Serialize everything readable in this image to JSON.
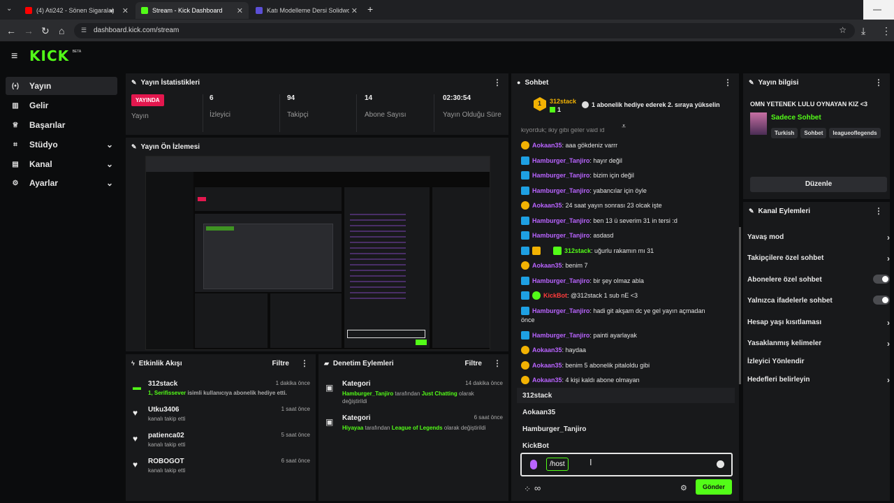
{
  "browser": {
    "tabs": [
      {
        "label": "(4) Ati242 - Sönen Sigaralar",
        "favicon_color": "#ff0000"
      },
      {
        "label": "Stream - Kick Dashboard",
        "favicon_color": "#53fc18"
      },
      {
        "label": "Katı Modelleme Dersi Solidworks",
        "favicon_color": "#5b4fd6"
      }
    ],
    "url": "dashboard.kick.com/stream"
  },
  "brand": {
    "logo": "KICK",
    "beta": "BETA",
    "accent": "#53fc18"
  },
  "sidebar": {
    "items": [
      {
        "label": "Yayın",
        "icon": "broadcast-icon"
      },
      {
        "label": "Gelir",
        "icon": "revenue-icon"
      },
      {
        "label": "Başarılar",
        "icon": "trophy-icon"
      },
      {
        "label": "Stüdyo",
        "icon": "studio-icon"
      },
      {
        "label": "Kanal",
        "icon": "channel-icon"
      },
      {
        "label": "Ayarlar",
        "icon": "gear-icon"
      }
    ]
  },
  "stats": {
    "title": "Yayın İstatistikleri",
    "live_badge": "YAYINDA",
    "live_label": "Yayın",
    "viewers": {
      "value": "6",
      "label": "İzleyici"
    },
    "followers": {
      "value": "94",
      "label": "Takipçi"
    },
    "subs": {
      "value": "14",
      "label": "Abone Sayısı"
    },
    "uptime": {
      "value": "02:30:54",
      "label": "Yayın Olduğu Süre"
    }
  },
  "preview": {
    "title": "Yayın Ön İzlemesi"
  },
  "events": {
    "title": "Etkinlik Akışı",
    "filter": "Filtre",
    "rows": [
      {
        "name": "312stack",
        "desc_a": "1, Serifissever",
        "desc_b": " isimli kullanıcıya abonelik hediye etti.",
        "time": "1 dakika önce"
      },
      {
        "name": "Utku3406",
        "desc": "kanalı takip etti",
        "time": "1 saat önce"
      },
      {
        "name": "patienca02",
        "desc": "kanalı takip etti",
        "time": "5 saat önce"
      },
      {
        "name": "ROBOGOT",
        "desc": "kanalı takip etti",
        "time": "6 saat önce"
      }
    ]
  },
  "moderation": {
    "title": "Denetim Eylemleri",
    "filter": "Filtre",
    "rows": [
      {
        "label": "Kategori",
        "user": "Hamburger_Tanjiro",
        "mid": " tarafından ",
        "cat": "Just Chatting",
        "end": " olarak değiştirildi",
        "time": "14 dakika önce"
      },
      {
        "label": "Kategori",
        "user": "Hiyayaa",
        "mid": " tarafından ",
        "cat": "League of Legends",
        "end": " olarak değiştirildi",
        "time": "6 saat önce"
      }
    ]
  },
  "chat": {
    "title": "Sohbet",
    "pinned": {
      "user": "312stack",
      "count": "1",
      "message": "1 abonelik hediye ederek 2. sıraya yükselin"
    },
    "truncated_top": "kıyorduk; ikiy gibi geler vaid id",
    "messages": [
      {
        "user": "Aokaan35",
        "text": ": aaa gökdeniz varrr",
        "badge": "gold",
        "color": "purple"
      },
      {
        "user": "Hamburger_Tanjiro",
        "text": ": hayır değil",
        "badge": "blue",
        "color": "purple"
      },
      {
        "user": "Hamburger_Tanjiro",
        "text": ": bizim için değil",
        "badge": "blue",
        "color": "purple"
      },
      {
        "user": "Hamburger_Tanjiro",
        "text": ": yabancılar için öyle",
        "badge": "blue",
        "color": "purple"
      },
      {
        "user": "Aokaan35",
        "text": ": 24 saat yayın sonrası 23 olcak işte",
        "badge": "gold",
        "color": "purple"
      },
      {
        "user": "Hamburger_Tanjiro",
        "text": ": ben 13 ü severim 31 in tersi :d",
        "badge": "blue",
        "color": "purple"
      },
      {
        "user": "Hamburger_Tanjiro",
        "text": ": asdasd",
        "badge": "blue",
        "color": "purple"
      },
      {
        "user": "312stack",
        "text": ": uğurlu rakamın mı 31",
        "badge": "blue",
        "color": "green"
      },
      {
        "user": "Aokaan35",
        "text": ": benim 7",
        "badge": "gold",
        "color": "purple"
      },
      {
        "user": "Hamburger_Tanjiro",
        "text": ": bir şey olmaz abla",
        "badge": "blue",
        "color": "purple"
      },
      {
        "user": "KickBot",
        "text": ": @312stack 1 sub nE <3",
        "badge": "blue",
        "color": "red"
      },
      {
        "user": "Hamburger_Tanjiro",
        "text": ": hadi git akşam dc ye gel yayın açmadan",
        "text2": "önce",
        "badge": "blue",
        "color": "purple"
      },
      {
        "user": "Hamburger_Tanjiro",
        "text": ": painti ayarlayak",
        "badge": "blue",
        "color": "purple"
      },
      {
        "user": "Aokaan35",
        "text": ": haydaa",
        "badge": "gold",
        "color": "purple"
      },
      {
        "user": "Aokaan35",
        "text": ": benim 5 abonelik pitaloldu gibi",
        "badge": "gold",
        "color": "purple"
      },
      {
        "user": "Aokaan35",
        "text": ": 4 kişi kaldı abone olmayan",
        "badge": "gold",
        "color": "purple"
      }
    ],
    "suggestions": [
      "312stack",
      "Aokaan35",
      "Hamburger_Tanjiro",
      "KickBot"
    ],
    "input_value": "/host",
    "send": "Gönder"
  },
  "info": {
    "title": "Yayın bilgisi",
    "stream_title": "OMN YETENEK LULU OYNAYAN KIZ <3",
    "category": "Sadece Sohbet",
    "tags": [
      "Turkish",
      "Sohbet",
      "leagueoflegends"
    ],
    "edit": "Düzenle"
  },
  "actions": {
    "title": "Kanal Eylemleri",
    "rows": [
      {
        "label": "Yavaş mod",
        "type": "chevron"
      },
      {
        "label": "Takipçilere özel sohbet",
        "type": "chevron"
      },
      {
        "label": "Abonelere özel sohbet",
        "type": "toggle"
      },
      {
        "label": "Yalnızca ifadelerle sohbet",
        "type": "toggle"
      },
      {
        "label": "Hesap yaşı kısıtlaması",
        "type": "chevron"
      },
      {
        "label": "Yasaklanmış kelimeler",
        "type": "chevron"
      },
      {
        "label": "İzleyici Yönlendir",
        "type": "none"
      },
      {
        "label": "Hedefleri belirleyin",
        "type": "chevron"
      }
    ]
  }
}
